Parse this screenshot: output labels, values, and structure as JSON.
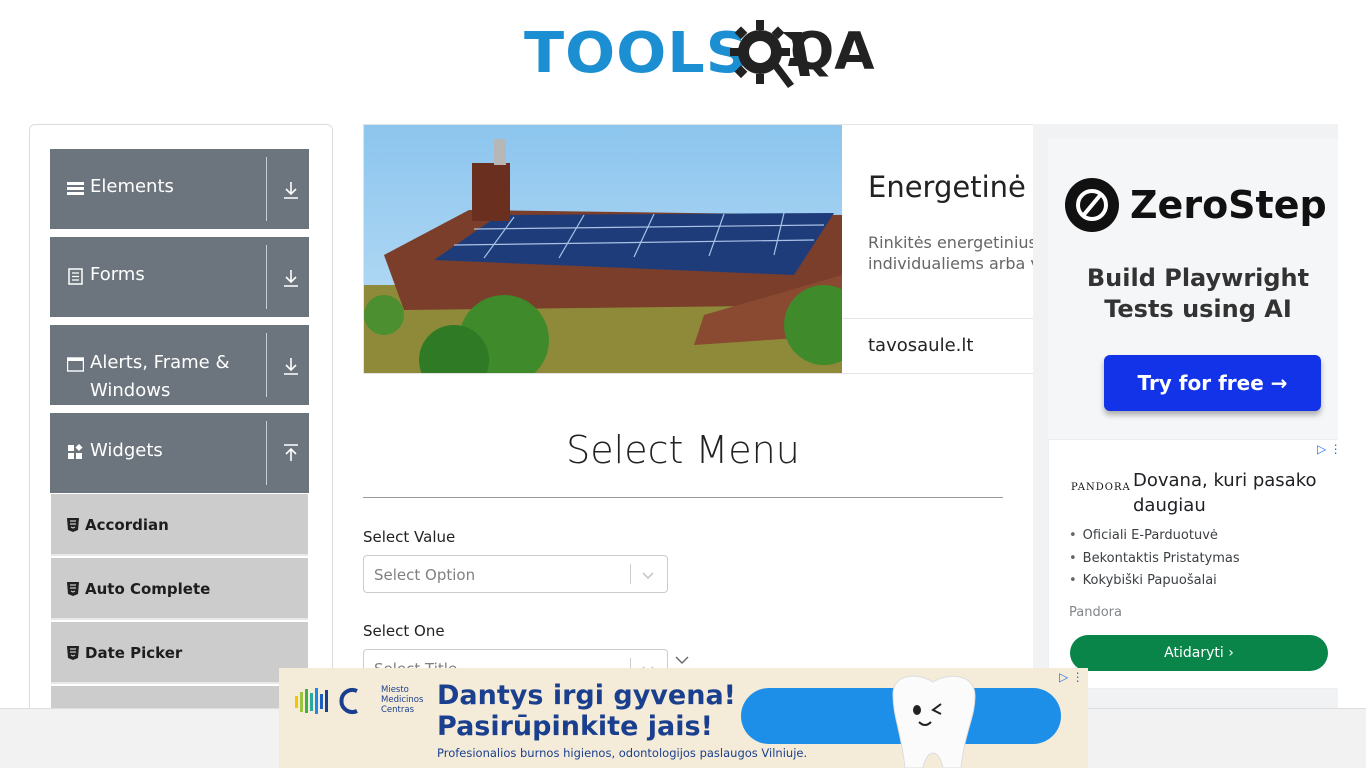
{
  "logo": {
    "tools": "TOOLS",
    "qa": "QA"
  },
  "sidebar": {
    "groups": [
      {
        "label": "Elements"
      },
      {
        "label": "Forms"
      },
      {
        "label": "Alerts, Frame & Windows"
      },
      {
        "label": "Widgets"
      }
    ],
    "widget_items": [
      {
        "label": "Accordian"
      },
      {
        "label": "Auto Complete"
      },
      {
        "label": "Date Picker"
      }
    ]
  },
  "top_ad": {
    "headline": "Energetinė n",
    "desc_line1": "Rinkitės energetinius",
    "desc_line2": "individualiems arba v",
    "domain": "tavosaule.lt"
  },
  "main": {
    "title": "Select Menu",
    "select_value": {
      "label": "Select Value",
      "placeholder": "Select Option"
    },
    "select_one": {
      "label": "Select One",
      "placeholder": "Select Title"
    }
  },
  "right_ads": {
    "zerostep": {
      "name": "ZeroStep",
      "tagline_line1": "Build Playwright",
      "tagline_line2": "Tests using AI",
      "button": "Try for free →"
    },
    "pandora": {
      "logo": "PANDORA",
      "title": "Dovana, kuri pasako daugiau",
      "bullets": [
        "Oficiali E-Parduotuvė",
        "Bekontaktis Pristatymas",
        "Kokybiški Papuošalai"
      ],
      "advertiser": "Pandora",
      "button": "Atidaryti"
    }
  },
  "bottom_ad": {
    "brand_line1": "Miesto",
    "brand_line2": "Medicinos",
    "brand_line3": "Centras",
    "headline_line1": "Dantys irgi gyvena!",
    "headline_line2": "Pasirūpinkite jais!",
    "sub": "Profesionalios burnos higienos, odontologijos paslaugos Vilniuje."
  },
  "colors": {
    "sidebar_group": "#6c757d",
    "sidebar_item": "#cccccc",
    "logo_blue": "#1b8fd1",
    "zerostep_button": "#1233e8",
    "pandora_button": "#0a8549"
  }
}
